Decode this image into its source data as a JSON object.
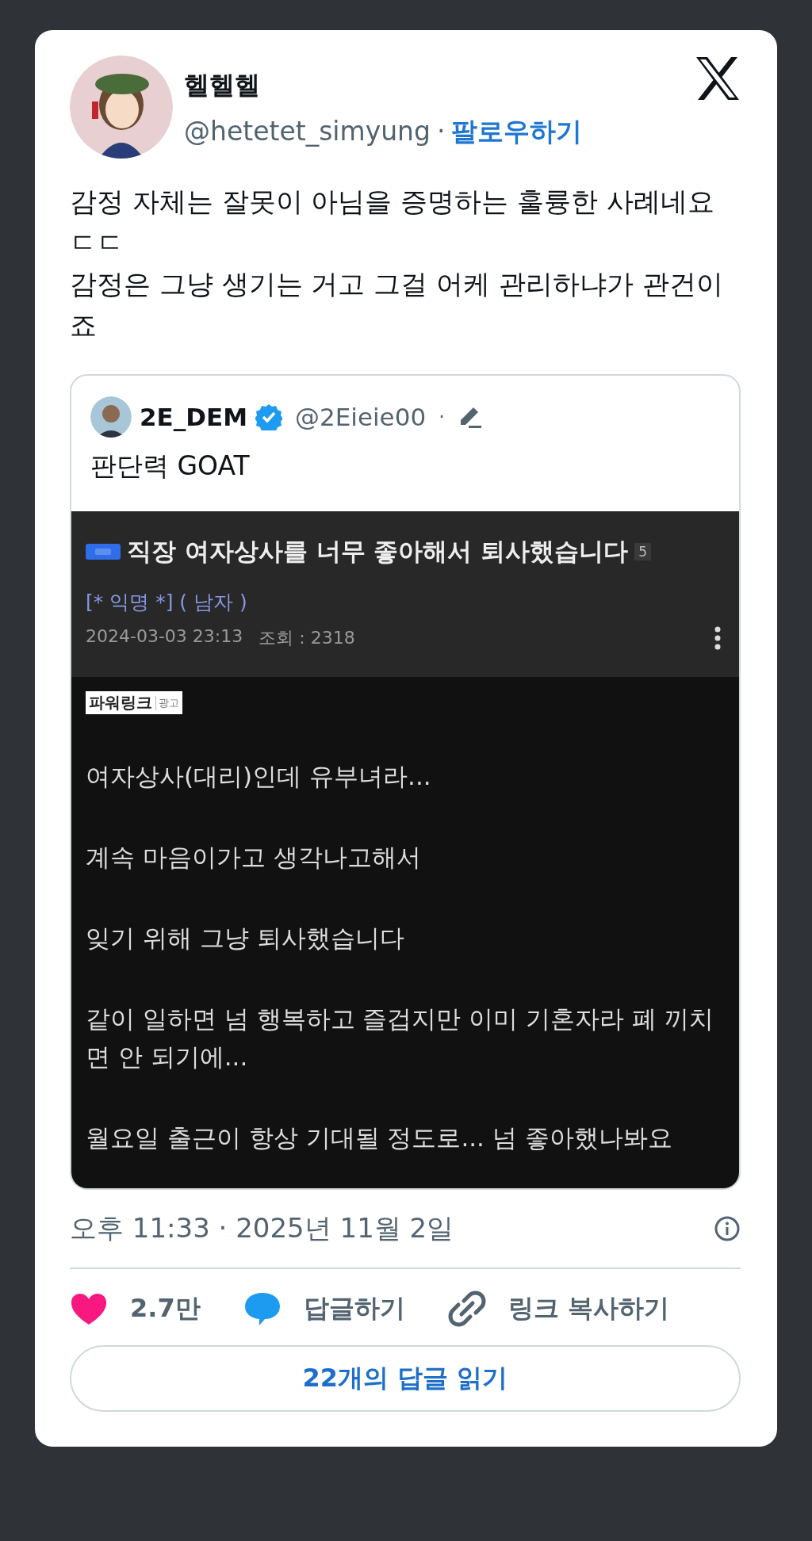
{
  "author": {
    "name": "헬헬헬",
    "handle": "@hetetet_simyung",
    "separator": "·",
    "follow": "팔로우하기"
  },
  "body": [
    "감정 자체는 잘못이 아님을 증명하는 훌륭한 사례네요 ㄷㄷ",
    "감정은 그냥 생기는 거고 그걸 어케 관리하냐가 관건이죠"
  ],
  "quote": {
    "name": "2E_DEM",
    "verified": true,
    "handle": "@2Eieie00",
    "separator": "·",
    "text": "판단력 GOAT",
    "post": {
      "title": "직장 여자상사를 너무 좋아해서 퇴사했습니다",
      "comments": "5",
      "author": "[* 익명 *] ( 남자 )",
      "date": "2024-03-03 23:13",
      "views": "조회 : 2318",
      "ad": "파워링크",
      "ad_tag": "광고",
      "paragraphs": [
        "여자상사(대리)인데 유부녀라...",
        "계속 마음이가고 생각나고해서",
        "잊기 위해 그냥 퇴사했습니다",
        "같이 일하면 넘 행복하고 즐겁지만 이미 기혼자라 폐 끼치면 안 되기에...",
        "월요일 출근이 항상 기대될 정도로... 넘 좋아했나봐요"
      ]
    }
  },
  "timestamp": "오후 11:33 · 2025년 11월 2일",
  "actions": [
    {
      "kind": "like",
      "label": "2.7만"
    },
    {
      "kind": "reply",
      "label": "답글하기"
    },
    {
      "kind": "link",
      "label": "링크 복사하기"
    }
  ],
  "read_replies": "22개의 답글 읽기"
}
